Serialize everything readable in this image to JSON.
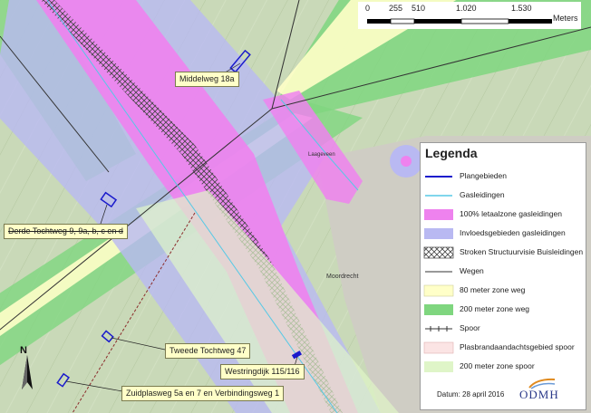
{
  "map": {
    "labels": {
      "middelweg": "Middelweg 18a",
      "derde_tochtweg": "Derde Tochtweg 9, 9a, b, c en d",
      "tweede_tochtweg": "Tweede Tochtweg 47",
      "westringdijk": "Westringdijk 115/116",
      "zuidplasweg": "Zuidplasweg 5a en 7 en Verbindingsweg 1"
    },
    "place_names": {
      "a": "Laageveen",
      "b": "Moordrecht"
    }
  },
  "scalebar": {
    "ticks": [
      "0",
      "255",
      "510",
      "1.020",
      "1.530"
    ],
    "units": "Meters"
  },
  "legend": {
    "title": "Legenda",
    "items": [
      {
        "label": "Plangebieden",
        "color": "#1a1acc",
        "icon": "dark-blue-line"
      },
      {
        "label": "Gasleidingen",
        "color": "#56c9e6",
        "icon": "light-blue-line"
      },
      {
        "label": "100% letaalzone gasleidingen",
        "color": "#ee82ee",
        "icon": "magenta-fill"
      },
      {
        "label": "Invloedsgebieden gasleidingen",
        "color": "#b9b9f2",
        "icon": "lavender-fill"
      },
      {
        "label": "Stroken Structuurvisie Buisleidingen",
        "color": "#555555",
        "icon": "crosshatch-fill"
      },
      {
        "label": "Wegen",
        "color": "#333333",
        "icon": "black-line"
      },
      {
        "label": "80 meter zone weg",
        "color": "#ffffc8",
        "icon": "pale-yellow-fill"
      },
      {
        "label": "200 meter zone weg",
        "color": "#7fd67f",
        "icon": "green-fill"
      },
      {
        "label": "Spoor",
        "color": "#333333",
        "icon": "rail-line"
      },
      {
        "label": "Plasbrandaandachtsgebied spoor",
        "color": "#fbe4e4",
        "icon": "pink-fill"
      },
      {
        "label": "200 meter zone spoor",
        "color": "#dff5c8",
        "icon": "pale-green-fill"
      }
    ],
    "date": "Datum: 28 april 2016",
    "organization": "ODMH"
  },
  "north_arrow": {
    "letter": "N"
  }
}
